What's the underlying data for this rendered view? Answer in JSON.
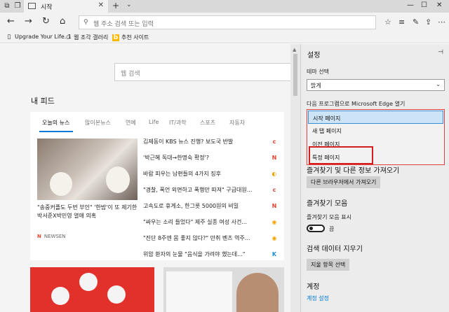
{
  "browser": {
    "tab_title": "시작",
    "address_placeholder": "웹 주소 검색 또는 입력"
  },
  "favorites": [
    {
      "label": "Upgrade Your Life. 1",
      "icon": "page-icon"
    },
    {
      "label": "웹 조각 갤러리",
      "icon": "star-icon"
    },
    {
      "label": "추천 사이트",
      "icon": "bing-icon"
    }
  ],
  "page": {
    "search_placeholder": "웹 검색",
    "feed_title": "내 피드",
    "feed_tabs": [
      "오늘의 뉴스",
      "많이본뉴스",
      "연예",
      "Life",
      "IT/과학",
      "스포츠",
      "자동차"
    ],
    "headline": "\"송중커플도 두번 부인\" '한밤'이 또 제기한 박서준X박민영 열애 의혹",
    "source": "NEWSEN",
    "source_logo": "N",
    "news": [
      {
        "text": "김제동이 KBS 뉴스 진행? 보도국 반발",
        "icon": "c",
        "color": "#e2442f"
      },
      {
        "text": "'박근혜 독대→한명숙 확정'?",
        "icon": "N",
        "color": "#e2442f"
      },
      {
        "text": "바람 피우는 남편들의 4가지 징후",
        "icon": "◐",
        "color": "#f0a500"
      },
      {
        "text": "\"경찰, 폭언 외면하고 폭행만 따져\" 구급대원...",
        "icon": "c",
        "color": "#e2442f"
      },
      {
        "text": "고속도로 휴게소, 한그릇 5000원의 비밀",
        "icon": "N",
        "color": "#e2442f"
      },
      {
        "text": "\"싸우는 소리 들었다\" 제주 실종 여성 사건...",
        "icon": "◉",
        "color": "#f0a500"
      },
      {
        "text": "\"진단 8주엔 몸 좋지 않다?\" 만취 벤츠 역주...",
        "icon": "◉",
        "color": "#f0a500"
      },
      {
        "text": "위암 환자의 눈물 \"음식을 가려야 했는데...\"",
        "icon": "K",
        "color": "#1a8fd6"
      }
    ]
  },
  "settings": {
    "title": "설정",
    "theme_label": "테마 선택",
    "theme_value": "밝게",
    "open_with_label": "다음 프로그램으로 Microsoft Edge 열기",
    "open_with_options": [
      "시작 페이지",
      "새 탭 페이지",
      "이전 페이지",
      "특정 페이지"
    ],
    "import_section": "즐겨찾기 및 다른 정보 가져오기",
    "import_button": "다른 브라우저에서 가져오기",
    "favorites_section": "즐겨찾기 모음",
    "favorites_toggle_label": "즐겨찾기 모음 표시",
    "toggle_state": "끔",
    "clear_section": "검색 데이터 지우기",
    "clear_button": "지울 항목 선택",
    "account_section": "계정",
    "account_link": "계정 설정"
  }
}
